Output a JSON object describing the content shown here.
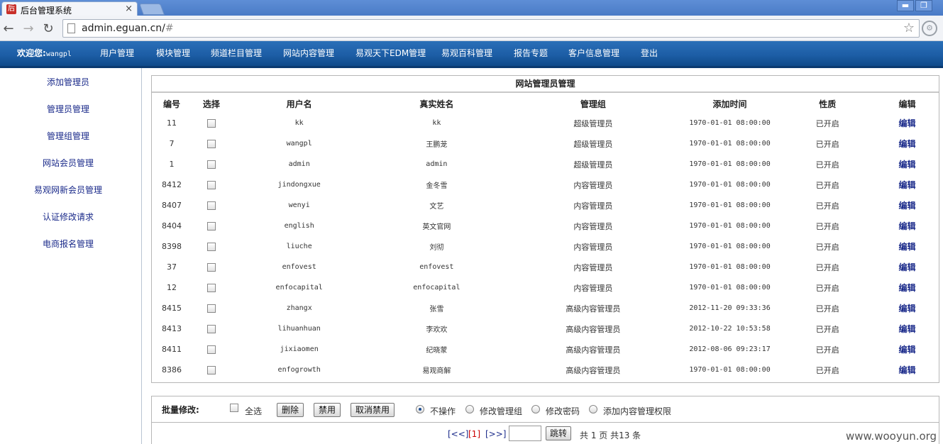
{
  "browser": {
    "tab_title": "后台管理系统",
    "tab_close": "×",
    "favicon_glyph": "后",
    "url_prefix": "admin.eguan.cn/",
    "url_suffix": "#",
    "win_min": "▬",
    "win_restore": "❐"
  },
  "topmenu": {
    "welcome_label": "欢迎您:",
    "welcome_user": "wangpl",
    "items": [
      "用户管理",
      "模块管理",
      "频道栏目管理",
      "网站内容管理",
      "易观天下EDM管理",
      "易观百科管理",
      "报告专题",
      "客户信息管理",
      "登出"
    ]
  },
  "sidebar": {
    "items": [
      "添加管理员",
      "管理员管理",
      "管理组管理",
      "网站会员管理",
      "易观网新会员管理",
      "认证修改请求",
      "电商报名管理"
    ]
  },
  "table": {
    "title": "网站管理员管理",
    "headers": [
      "编号",
      "选择",
      "用户名",
      "真实姓名",
      "管理组",
      "添加时间",
      "性质",
      "编辑"
    ],
    "rows": [
      {
        "id": "11",
        "username": "kk",
        "realname": "kk",
        "group": "超级管理员",
        "time": "1970-01-01 08:00:00",
        "status": "已开启",
        "edit": "编辑"
      },
      {
        "id": "7",
        "username": "wangpl",
        "realname": "王鹏茏",
        "group": "超级管理员",
        "time": "1970-01-01 08:00:00",
        "status": "已开启",
        "edit": "编辑"
      },
      {
        "id": "1",
        "username": "admin",
        "realname": "admin",
        "group": "超级管理员",
        "time": "1970-01-01 08:00:00",
        "status": "已开启",
        "edit": "编辑"
      },
      {
        "id": "8412",
        "username": "jindongxue",
        "realname": "金冬雪",
        "group": "内容管理员",
        "time": "1970-01-01 08:00:00",
        "status": "已开启",
        "edit": "编辑"
      },
      {
        "id": "8407",
        "username": "wenyi",
        "realname": "文艺",
        "group": "内容管理员",
        "time": "1970-01-01 08:00:00",
        "status": "已开启",
        "edit": "编辑"
      },
      {
        "id": "8404",
        "username": "english",
        "realname": "英文官网",
        "group": "内容管理员",
        "time": "1970-01-01 08:00:00",
        "status": "已开启",
        "edit": "编辑"
      },
      {
        "id": "8398",
        "username": "liuche",
        "realname": "刘彻",
        "group": "内容管理员",
        "time": "1970-01-01 08:00:00",
        "status": "已开启",
        "edit": "编辑"
      },
      {
        "id": "37",
        "username": "enfovest",
        "realname": "enfovest",
        "group": "内容管理员",
        "time": "1970-01-01 08:00:00",
        "status": "已开启",
        "edit": "编辑"
      },
      {
        "id": "12",
        "username": "enfocapital",
        "realname": "enfocapital",
        "group": "内容管理员",
        "time": "1970-01-01 08:00:00",
        "status": "已开启",
        "edit": "编辑"
      },
      {
        "id": "8415",
        "username": "zhangx",
        "realname": "张雪",
        "group": "高级内容管理员",
        "time": "2012-11-20 09:33:36",
        "status": "已开启",
        "edit": "编辑"
      },
      {
        "id": "8413",
        "username": "lihuanhuan",
        "realname": "李欢欢",
        "group": "高级内容管理员",
        "time": "2012-10-22 10:53:58",
        "status": "已开启",
        "edit": "编辑"
      },
      {
        "id": "8411",
        "username": "jixiaomen",
        "realname": "纪晓蒙",
        "group": "高级内容管理员",
        "time": "2012-08-06 09:23:17",
        "status": "已开启",
        "edit": "编辑"
      },
      {
        "id": "8386",
        "username": "enfogrowth",
        "realname": "易观商解",
        "group": "高级内容管理员",
        "time": "1970-01-01 08:00:00",
        "status": "已开启",
        "edit": "编辑"
      }
    ]
  },
  "batch": {
    "label": "批量修改:",
    "select_all": "全选",
    "delete": "删除",
    "disable": "禁用",
    "enable": "取消禁用",
    "radio_none": "不操作",
    "radio_group": "修改管理组",
    "radio_password": "修改密码",
    "radio_permission": "添加内容管理权限",
    "selected_radio": "不操作"
  },
  "pager": {
    "prev": "[<<]",
    "current": "[1]",
    "next": "[>>]",
    "jump": "跳转",
    "summary": "共 1 页 共13 条"
  },
  "watermark": "www.wooyun.org"
}
